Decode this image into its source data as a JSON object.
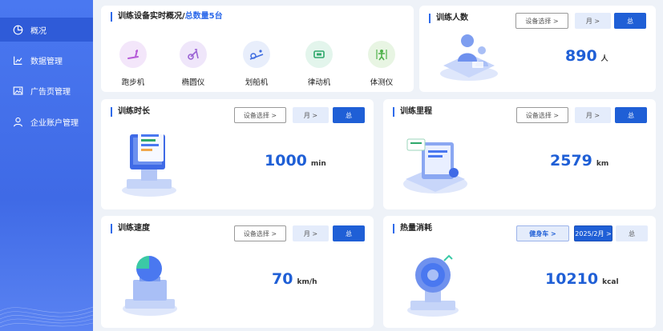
{
  "sidebar": {
    "items": [
      {
        "label": "概况",
        "icon": "pie-chart-icon",
        "active": true
      },
      {
        "label": "数据管理",
        "icon": "bar-chart-icon",
        "active": false
      },
      {
        "label": "广告页管理",
        "icon": "image-icon",
        "active": false
      },
      {
        "label": "企业账户管理",
        "icon": "user-icon",
        "active": false
      }
    ]
  },
  "overview": {
    "title": "训练设备实时概况/",
    "total": "总数量5台",
    "equipment": [
      {
        "label": "跑步机",
        "icon": "treadmill-icon",
        "color": "#b65bd8"
      },
      {
        "label": "椭圆仪",
        "icon": "elliptical-icon",
        "color": "#9a62d4"
      },
      {
        "label": "划船机",
        "icon": "rowing-machine-icon",
        "color": "#3f6de0"
      },
      {
        "label": "律动机",
        "icon": "vibration-machine-icon",
        "color": "#2ea86b"
      },
      {
        "label": "体测仪",
        "icon": "body-test-icon",
        "color": "#4fb24a"
      }
    ]
  },
  "cards": {
    "people": {
      "title": "训练人数",
      "device_btn": "设备选择 >",
      "month_btn": "月 >",
      "total_btn": "总",
      "value": "890",
      "unit": "人"
    },
    "duration": {
      "title": "训练时长",
      "device_btn": "设备选择 >",
      "month_btn": "月 >",
      "total_btn": "总",
      "value": "1000",
      "unit": "min"
    },
    "distance": {
      "title": "训练里程",
      "device_btn": "设备选择 >",
      "month_btn": "月 >",
      "total_btn": "总",
      "value": "2579",
      "unit": "km"
    },
    "speed": {
      "title": "训练速度",
      "device_btn": "设备选择 >",
      "month_btn": "月 >",
      "total_btn": "总",
      "value": "70",
      "unit": "km/h"
    },
    "calories": {
      "title": "热量消耗",
      "device_btn": "健身车 >",
      "month_btn": "2025/2月 >",
      "total_btn": "总",
      "value": "10210",
      "unit": "kcal"
    }
  },
  "colors": {
    "primary": "#1f5fd6",
    "sidebar": "#4a78f0",
    "background": "#eef2f8"
  }
}
